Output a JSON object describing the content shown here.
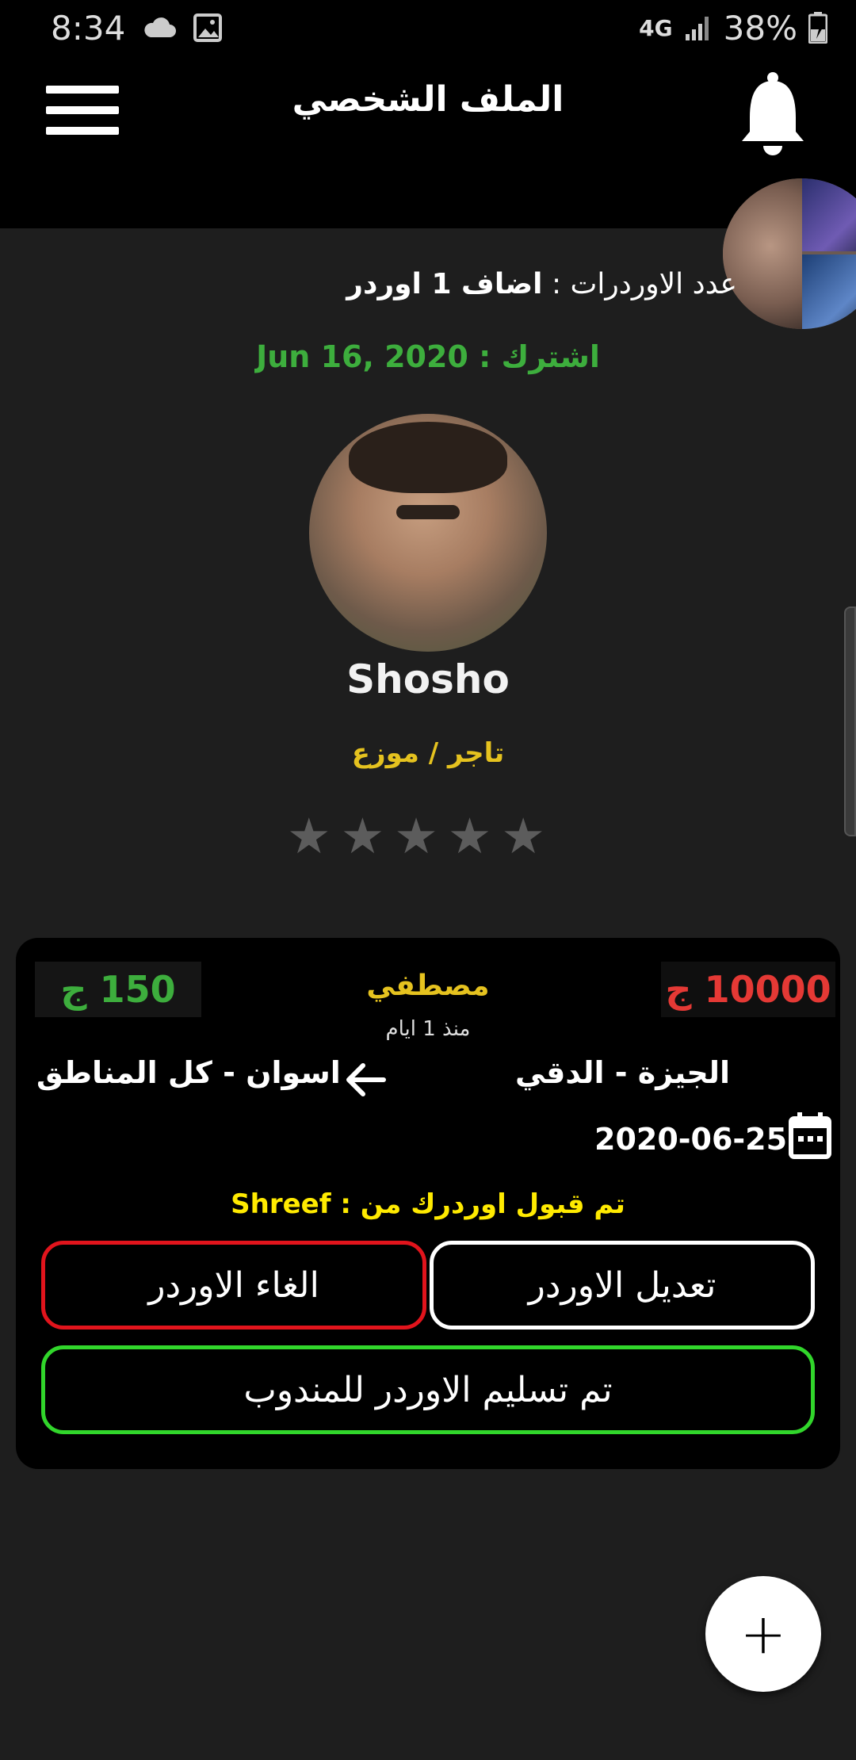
{
  "status_bar": {
    "time": "8:34",
    "network": "4G",
    "battery": "38%"
  },
  "header": {
    "title": "الملف الشخصي"
  },
  "profile": {
    "orders_count_label": "عدد الاوردرات :",
    "orders_count_value": "اضاف 1 اوردر",
    "joined": "اشترك : Jun 16, 2020",
    "name": "Shosho",
    "role": "تاجر / موزع",
    "rating": 0,
    "max_rating": 5
  },
  "order": {
    "price_left": "150 ج",
    "price_right": "10000 ج",
    "client_name": "مصطفي",
    "time_ago": "منذ 1 ايام",
    "to_location": "اسوان - كل المناطق",
    "from_location": "الجيزة - الدقي",
    "date": "2020-06-25",
    "accepted_text": "تم قبول اوردرك من : Shreef",
    "cancel_label": "الغاء الاوردر",
    "edit_label": "تعديل الاوردر",
    "deliver_label": "تم تسليم الاوردر للمندوب",
    "vehicles": [
      "metro-icon",
      "bus-icon",
      "car-icon"
    ]
  },
  "colors": {
    "accent_green": "#3dae3d",
    "price_red": "#e53935",
    "accent_yellow": "#e5c21f",
    "cancel_border": "#e1141c",
    "deliver_border": "#31d62b"
  },
  "fab": {
    "label": "+"
  }
}
